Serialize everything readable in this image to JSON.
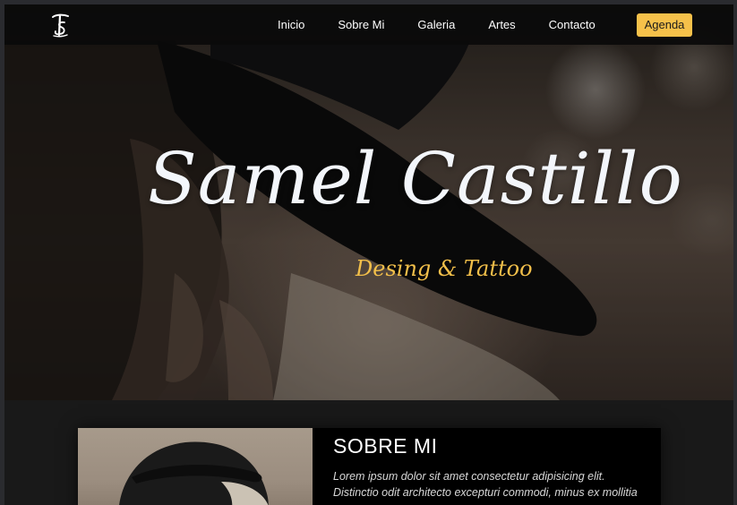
{
  "nav": {
    "logo_icon": "ts-monogram-logo",
    "links": [
      "Inicio",
      "Sobre Mi",
      "Galeria",
      "Artes",
      "Contacto"
    ],
    "cta_label": "Agenda",
    "cta_color": "#f6c14a"
  },
  "hero": {
    "title": "Samel Castillo",
    "subtitle": "Desing & Tattoo",
    "subtitle_color": "#f2bf4a"
  },
  "about": {
    "title": "SOBRE MI",
    "text_line1": "Lorem ipsum dolor sit amet consectetur adipisicing elit.",
    "text_line2": "Distinctio odit architecto excepturi commodi, minus ex mollitia"
  }
}
